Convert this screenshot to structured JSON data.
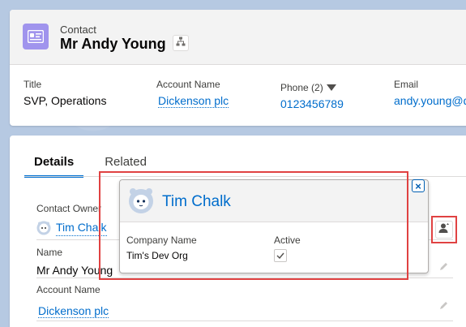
{
  "header": {
    "object_type": "Contact",
    "record_name": "Mr Andy Young",
    "fields": [
      {
        "label": "Title",
        "value": "SVP, Operations",
        "is_link": false
      },
      {
        "label": "Account Name",
        "value": "Dickenson plc",
        "is_link": true
      },
      {
        "label": "Phone (2)",
        "value": "0123456789",
        "is_link": true
      },
      {
        "label": "Email",
        "value": "andy.young@d",
        "is_link": true
      }
    ]
  },
  "tabs": [
    {
      "label": "Details",
      "active": true
    },
    {
      "label": "Related",
      "active": false
    }
  ],
  "details": {
    "contact_owner": {
      "label": "Contact Owner",
      "value": "Tim Chalk"
    },
    "name": {
      "label": "Name",
      "value": "Mr Andy Young"
    },
    "account_name": {
      "label": "Account Name",
      "value": "Dickenson plc"
    }
  },
  "popover": {
    "title": "Tim Chalk",
    "company_label": "Company Name",
    "company_value": "Tim's Dev Org",
    "active_label": "Active",
    "active_checked": true,
    "close_glyph": "×"
  },
  "colors": {
    "link": "#006dcc",
    "brand": "#0070d2",
    "contact_icon": "#a094ed",
    "highlight": "#e04242"
  },
  "icons": {
    "contact": "contact-card-icon",
    "hierarchy": "hierarchy-icon",
    "dropdown": "chevron-down-icon",
    "avatar": "astro-avatar-icon",
    "change_owner": "change-owner-icon",
    "edit": "pencil-icon",
    "check": "check-icon",
    "close": "close-icon"
  }
}
